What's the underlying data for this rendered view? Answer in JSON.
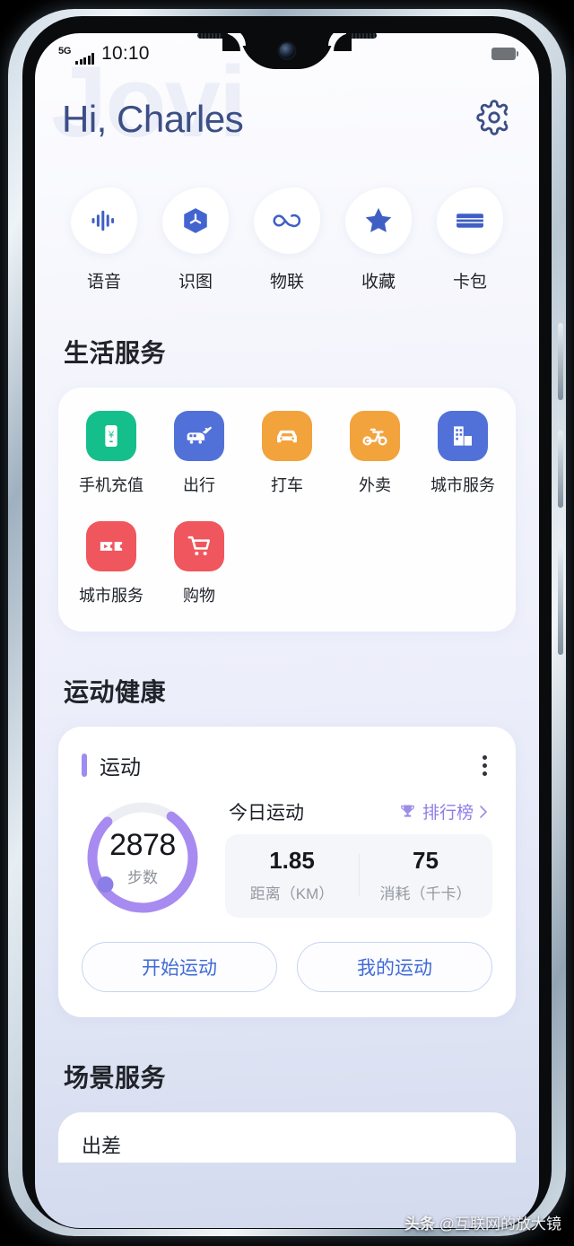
{
  "statusbar": {
    "network": "5G",
    "time": "10:10",
    "battery_icon": "battery-icon"
  },
  "header": {
    "greeting": "Hi, Charles",
    "watermark": "Jovi",
    "settings_icon": "gear-icon"
  },
  "quick_actions": {
    "items": [
      {
        "label": "语音",
        "icon": "waveform-icon"
      },
      {
        "label": "识图",
        "icon": "cube-icon"
      },
      {
        "label": "物联",
        "icon": "infinity-icon"
      },
      {
        "label": "收藏",
        "icon": "star-icon"
      },
      {
        "label": "卡包",
        "icon": "card-wallet-icon"
      }
    ]
  },
  "life_services": {
    "title": "生活服务",
    "items": [
      {
        "label": "手机充值",
        "icon": "phone-recharge-icon",
        "color": "#14bf8b"
      },
      {
        "label": "出行",
        "icon": "train-plane-icon",
        "color": "#5271d8"
      },
      {
        "label": "打车",
        "icon": "car-icon",
        "color": "#f2a33c"
      },
      {
        "label": "外卖",
        "icon": "scooter-icon",
        "color": "#f2a33c"
      },
      {
        "label": "城市服务",
        "icon": "city-buildings-icon",
        "color": "#5271d8"
      },
      {
        "label": "城市服务",
        "icon": "movie-ticket-icon",
        "color": "#f0565e"
      },
      {
        "label": "购物",
        "icon": "shopping-cart-icon",
        "color": "#f0565e"
      }
    ]
  },
  "sport_health": {
    "title": "运动健康",
    "card": {
      "title": "运动",
      "more_icon": "kebab-menu-icon",
      "steps_value": "2878",
      "steps_label": "步数",
      "ring_progress_pct": 78,
      "ring_color": "#a78bf0",
      "ring_track_color": "#edeef3",
      "today_label": "今日运动",
      "rank_label": "排行榜",
      "rank_icon": "trophy-icon",
      "rank_chevron": "chevron-right-icon",
      "stats": [
        {
          "value": "1.85",
          "label": "距离（KM）"
        },
        {
          "value": "75",
          "label": "消耗（千卡）"
        }
      ],
      "buttons": [
        {
          "label": "开始运动"
        },
        {
          "label": "我的运动"
        }
      ]
    }
  },
  "scene_services": {
    "title": "场景服务",
    "peek_text": "出差"
  },
  "overlay": {
    "watermark_brand": "头条",
    "watermark_handle": "@互联网的放大镜"
  }
}
